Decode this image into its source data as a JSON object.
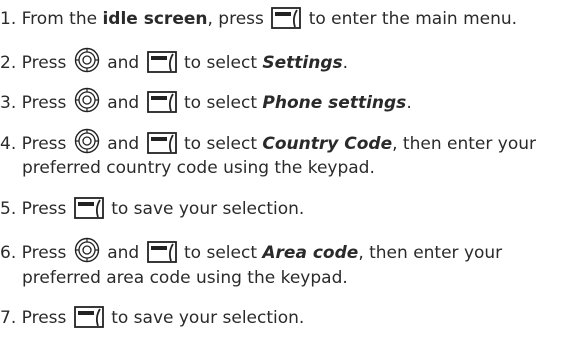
{
  "steps": [
    {
      "num": "1.",
      "p1": "From the ",
      "bold": "idle screen",
      "p2": ", press ",
      "p3": " to enter the main menu."
    },
    {
      "num": "2.",
      "p1": "Press ",
      "and": " and ",
      "sel": " to select ",
      "target": "Settings",
      "end": "."
    },
    {
      "num": "3.",
      "p1": "Press ",
      "and": " and ",
      "sel": " to select ",
      "target": "Phone settings",
      "end": "."
    },
    {
      "num": "4.",
      "p1": "Press ",
      "and": " and ",
      "sel": " to select ",
      "target": "Country Code",
      "end": ", then enter your",
      "line2": "preferred country code using the keypad."
    },
    {
      "num": "5.",
      "p1": "Press ",
      "p2": " to save your selection."
    },
    {
      "num": "6.",
      "p1": "Press ",
      "and": " and ",
      "sel": " to select ",
      "target": "Area code",
      "end": ", then enter your",
      "line2": "preferred area code using the keypad."
    },
    {
      "num": "7.",
      "p1": "Press ",
      "p2": " to save your selection."
    }
  ],
  "icons": {
    "softkey": "left-softkey-icon",
    "nav": "navigation-key-icon"
  }
}
